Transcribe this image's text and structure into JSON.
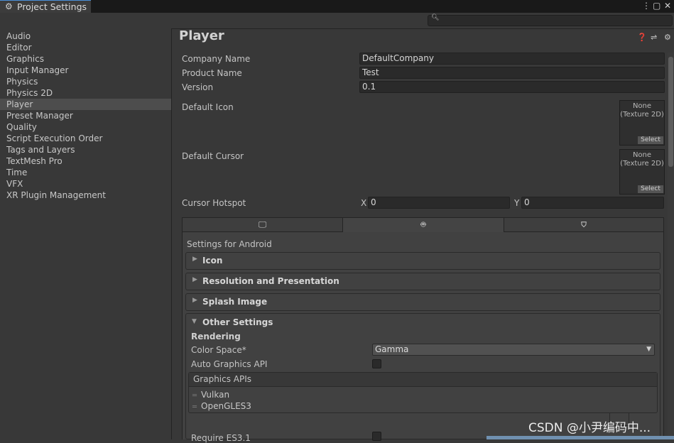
{
  "window": {
    "tab_title": "Project Settings",
    "icons": [
      "gear-icon",
      "more-menu-icon",
      "maximize-icon",
      "close-icon"
    ]
  },
  "search": {
    "value": "",
    "icon": "search-icon"
  },
  "sidebar": {
    "items": [
      {
        "label": "Audio"
      },
      {
        "label": "Editor"
      },
      {
        "label": "Graphics"
      },
      {
        "label": "Input Manager"
      },
      {
        "label": "Physics"
      },
      {
        "label": "Physics 2D"
      },
      {
        "label": "Player",
        "selected": true
      },
      {
        "label": "Preset Manager"
      },
      {
        "label": "Quality"
      },
      {
        "label": "Script Execution Order"
      },
      {
        "label": "Tags and Layers"
      },
      {
        "label": "TextMesh Pro"
      },
      {
        "label": "Time"
      },
      {
        "label": "VFX"
      },
      {
        "label": "XR Plugin Management"
      }
    ]
  },
  "main": {
    "title": "Player",
    "header_icons": [
      "help-icon",
      "presets-icon",
      "settings-icon"
    ],
    "company_name_label": "Company Name",
    "company_name_value": "DefaultCompany",
    "product_name_label": "Product Name",
    "product_name_value": "Test",
    "version_label": "Version",
    "version_value": "0.1",
    "default_icon_label": "Default Icon",
    "default_cursor_label": "Default Cursor",
    "texture_none": "None",
    "texture_type": "(Texture 2D)",
    "texture_select": "Select",
    "cursor_hotspot_label": "Cursor Hotspot",
    "hotspot_x_label": "X",
    "hotspot_x_value": "0",
    "hotspot_y_label": "Y",
    "hotspot_y_value": "0"
  },
  "platform_tabs": [
    {
      "icon": "monitor-icon",
      "active": false
    },
    {
      "icon": "android-icon",
      "active": true
    },
    {
      "icon": "html5-icon",
      "active": false
    }
  ],
  "platform": {
    "settings_for": "Settings for Android",
    "foldouts": [
      "Icon",
      "Resolution and Presentation",
      "Splash Image"
    ],
    "other_settings": "Other Settings",
    "rendering_heading": "Rendering",
    "color_space_label": "Color Space*",
    "color_space_value": "Gamma",
    "auto_graphics_label": "Auto Graphics API",
    "auto_graphics_checked": false,
    "graphics_apis_label": "Graphics APIs",
    "graphics_apis": [
      "Vulkan",
      "OpenGLES3"
    ],
    "cut_label": "Require ES3.1"
  },
  "watermark": "CSDN @小尹编码中..."
}
